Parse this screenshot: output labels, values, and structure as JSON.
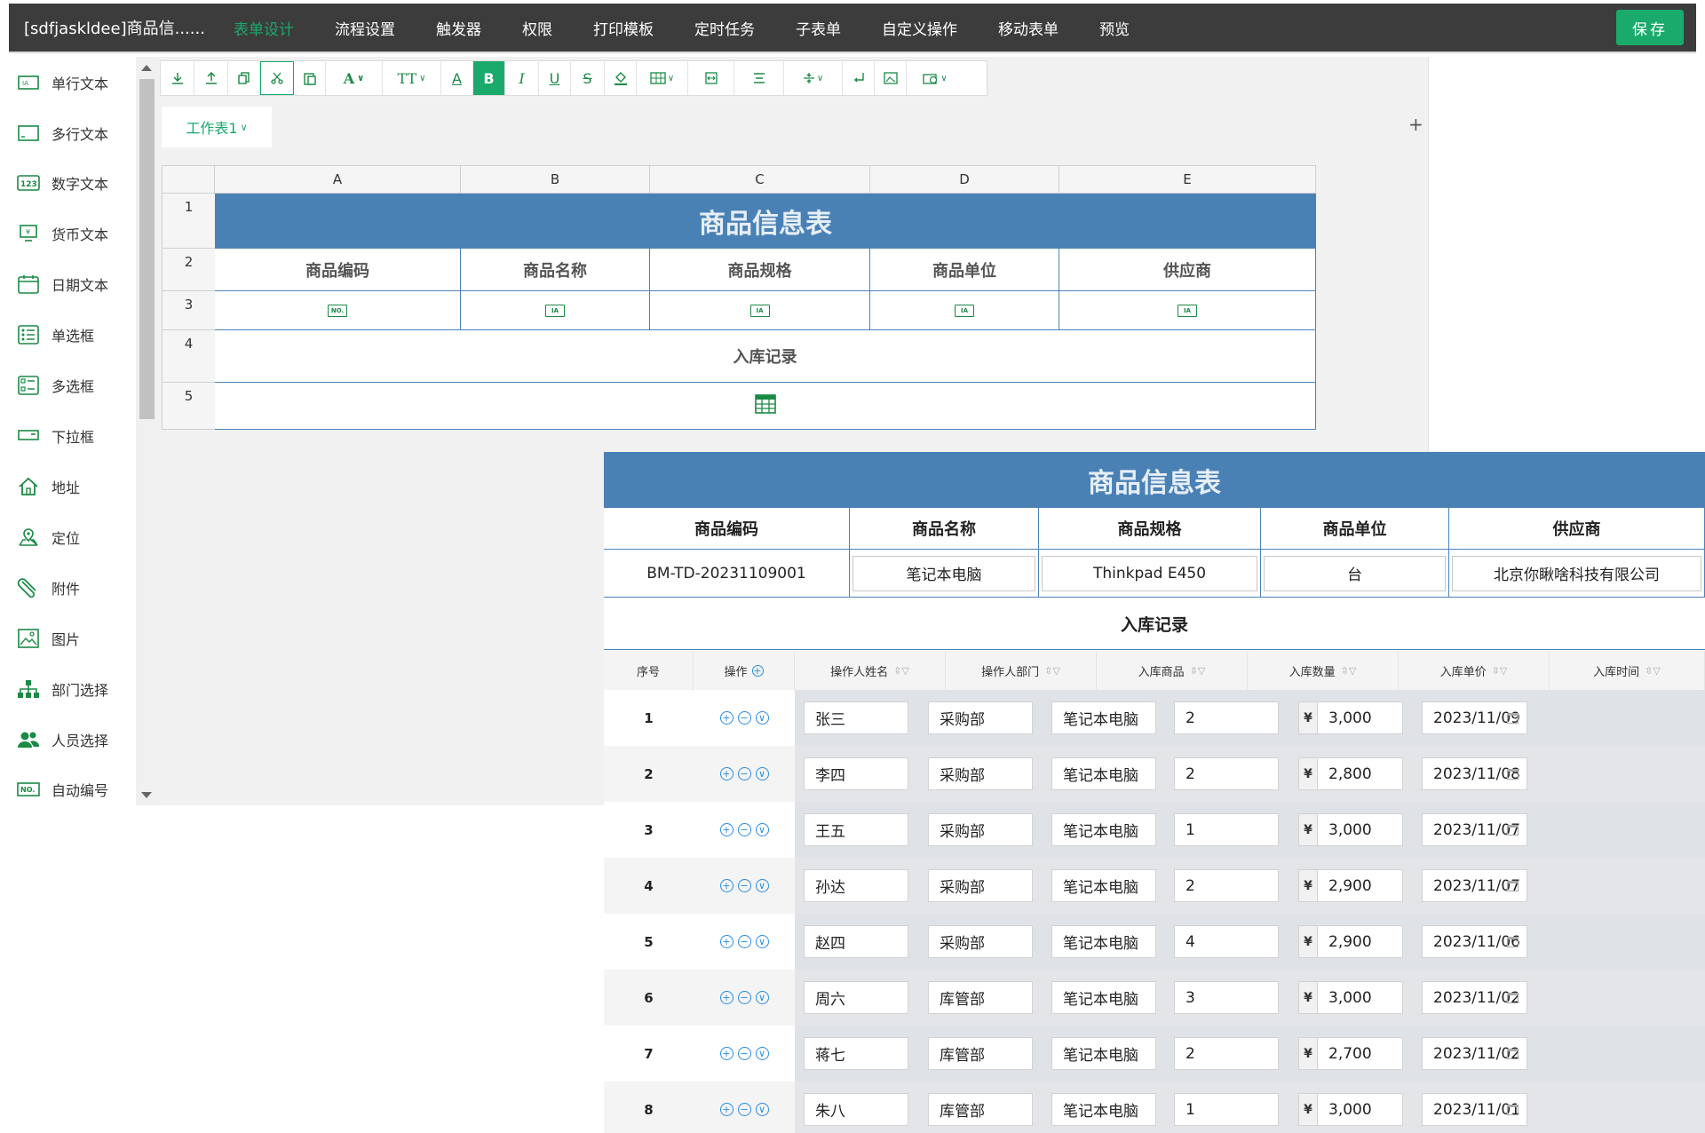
{
  "app": {
    "title": "[sdfjaskldee]商品信......",
    "save_label": "保存"
  },
  "nav": [
    {
      "label": "表单设计",
      "active": true
    },
    {
      "label": "流程设置"
    },
    {
      "label": "触发器"
    },
    {
      "label": "权限"
    },
    {
      "label": "打印模板"
    },
    {
      "label": "定时任务"
    },
    {
      "label": "子表单"
    },
    {
      "label": "自定义操作"
    },
    {
      "label": "移动表单"
    },
    {
      "label": "预览"
    }
  ],
  "palette": [
    {
      "label": "单行文本",
      "icon": "single-line-text-icon"
    },
    {
      "label": "多行文本",
      "icon": "multi-line-text-icon"
    },
    {
      "label": "数字文本",
      "icon": "number-text-icon"
    },
    {
      "label": "货币文本",
      "icon": "currency-text-icon"
    },
    {
      "label": "日期文本",
      "icon": "date-text-icon"
    },
    {
      "label": "单选框",
      "icon": "radio-icon"
    },
    {
      "label": "多选框",
      "icon": "checkbox-icon"
    },
    {
      "label": "下拉框",
      "icon": "dropdown-icon"
    },
    {
      "label": "地址",
      "icon": "home-icon"
    },
    {
      "label": "定位",
      "icon": "location-icon"
    },
    {
      "label": "附件",
      "icon": "paperclip-icon"
    },
    {
      "label": "图片",
      "icon": "image-icon"
    },
    {
      "label": "部门选择",
      "icon": "org-chart-icon"
    },
    {
      "label": "人员选择",
      "icon": "users-icon"
    },
    {
      "label": "自动编号",
      "icon": "auto-number-icon"
    }
  ],
  "toolbar": {
    "font_glyph": "A",
    "size_glyph": "TT",
    "color_glyph": "A",
    "bold_glyph": "B",
    "italic_glyph": "I",
    "underline_glyph": "U",
    "strike_glyph": "S"
  },
  "sheet": {
    "tab_label": "工作表1",
    "add_label": "+"
  },
  "grid": {
    "columns": [
      "A",
      "B",
      "C",
      "D",
      "E"
    ],
    "rows": [
      "1",
      "2",
      "3",
      "4",
      "5"
    ],
    "title": "商品信息表",
    "headers": [
      "商品编码",
      "商品名称",
      "商品规格",
      "商品单位",
      "供应商"
    ],
    "field_icons": [
      "NO.",
      "IA",
      "IA",
      "IA",
      "IA"
    ],
    "section": "入库记录"
  },
  "preview": {
    "title": "商品信息表",
    "headers": [
      "商品编码",
      "商品名称",
      "商品规格",
      "商品单位",
      "供应商"
    ],
    "values": [
      "BM-TD-20231109001",
      "笔记本电脑",
      "Thinkpad E450",
      "台",
      "北京你瞅啥科技有限公司"
    ],
    "section": "入库记录",
    "sub_headers": [
      "序号",
      "操作",
      "操作人姓名",
      "操作人部门",
      "入库商品",
      "入库数量",
      "入库单价",
      "入库时间"
    ],
    "currency_symbol": "¥",
    "rows": [
      {
        "seq": "1",
        "name": "张三",
        "dept": "采购部",
        "product": "笔记本电脑",
        "qty": "2",
        "price": "3,000",
        "date": "2023/11/09"
      },
      {
        "seq": "2",
        "name": "李四",
        "dept": "采购部",
        "product": "笔记本电脑",
        "qty": "2",
        "price": "2,800",
        "date": "2023/11/08"
      },
      {
        "seq": "3",
        "name": "王五",
        "dept": "采购部",
        "product": "笔记本电脑",
        "qty": "1",
        "price": "3,000",
        "date": "2023/11/07"
      },
      {
        "seq": "4",
        "name": "孙达",
        "dept": "采购部",
        "product": "笔记本电脑",
        "qty": "2",
        "price": "2,900",
        "date": "2023/11/07"
      },
      {
        "seq": "5",
        "name": "赵四",
        "dept": "采购部",
        "product": "笔记本电脑",
        "qty": "4",
        "price": "2,900",
        "date": "2023/11/06"
      },
      {
        "seq": "6",
        "name": "周六",
        "dept": "库管部",
        "product": "笔记本电脑",
        "qty": "3",
        "price": "3,000",
        "date": "2023/11/02"
      },
      {
        "seq": "7",
        "name": "蒋七",
        "dept": "库管部",
        "product": "笔记本电脑",
        "qty": "2",
        "price": "2,700",
        "date": "2023/11/02"
      },
      {
        "seq": "8",
        "name": "朱八",
        "dept": "库管部",
        "product": "笔记本电脑",
        "qty": "1",
        "price": "3,000",
        "date": "2023/11/01"
      }
    ]
  },
  "colors": {
    "accent": "#1aaa6b",
    "header_blue": "#4a81b5",
    "topbar": "#3c3c3c",
    "link_blue": "#2a8de0"
  }
}
